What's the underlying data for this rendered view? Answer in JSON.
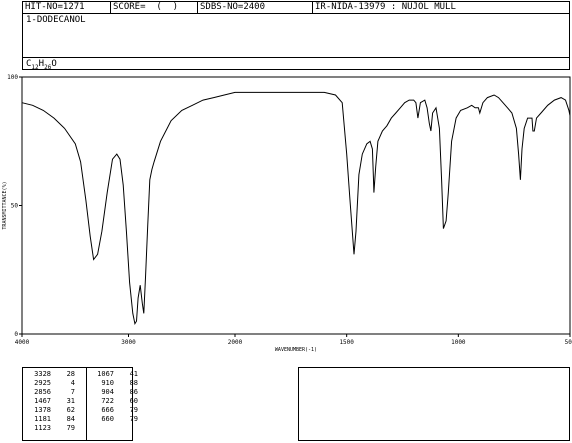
{
  "header": {
    "hit_no": "HIT-NO=1271",
    "score": "SCORE=  (  )",
    "sdbs_no": "SDBS-NO=2400",
    "ir_info": "IR-NIDA-13979 : NUJOL MULL"
  },
  "compound": {
    "name": "1-DODECANOL",
    "formula_c": "C",
    "formula_c_sub": "12",
    "formula_h": "H",
    "formula_h_sub": "26",
    "formula_o": "O"
  },
  "chart_data": {
    "type": "line",
    "xlabel": "WAVENUMBER(-1)",
    "ylabel": "TRANSMITTANCE(%)",
    "xlim": [
      4000,
      500
    ],
    "ylim": [
      0,
      100
    ],
    "x_ticks": [
      {
        "value": 4000,
        "label": "4000"
      },
      {
        "value": 3000,
        "label": "3000"
      },
      {
        "value": 2000,
        "label": "2000"
      },
      {
        "value": 1500,
        "label": "1500"
      },
      {
        "value": 1000,
        "label": "1000"
      },
      {
        "value": 500,
        "label": "500"
      }
    ],
    "y_ticks": [
      {
        "value": 100,
        "label": "100"
      },
      {
        "value": 50,
        "label": "50"
      },
      {
        "value": 0,
        "label": "0"
      }
    ],
    "series": [
      {
        "color": "#000000",
        "points": [
          [
            4000,
            90
          ],
          [
            3900,
            89
          ],
          [
            3800,
            87
          ],
          [
            3700,
            84
          ],
          [
            3600,
            80
          ],
          [
            3500,
            74
          ],
          [
            3450,
            67
          ],
          [
            3400,
            52
          ],
          [
            3360,
            38
          ],
          [
            3328,
            29
          ],
          [
            3290,
            31
          ],
          [
            3250,
            40
          ],
          [
            3200,
            55
          ],
          [
            3150,
            68
          ],
          [
            3110,
            70
          ],
          [
            3080,
            68
          ],
          [
            3050,
            58
          ],
          [
            3020,
            40
          ],
          [
            2990,
            20
          ],
          [
            2960,
            8
          ],
          [
            2940,
            4
          ],
          [
            2925,
            5
          ],
          [
            2910,
            14
          ],
          [
            2890,
            19
          ],
          [
            2870,
            12
          ],
          [
            2856,
            8
          ],
          [
            2840,
            22
          ],
          [
            2820,
            42
          ],
          [
            2800,
            60
          ],
          [
            2780,
            64
          ],
          [
            2760,
            67
          ],
          [
            2700,
            75
          ],
          [
            2600,
            83
          ],
          [
            2500,
            87
          ],
          [
            2400,
            89
          ],
          [
            2300,
            91
          ],
          [
            2200,
            92
          ],
          [
            2100,
            93
          ],
          [
            2000,
            94
          ],
          [
            1900,
            94
          ],
          [
            1800,
            94
          ],
          [
            1700,
            94
          ],
          [
            1600,
            94
          ],
          [
            1550,
            93
          ],
          [
            1520,
            90
          ],
          [
            1500,
            70
          ],
          [
            1485,
            52
          ],
          [
            1467,
            31
          ],
          [
            1458,
            40
          ],
          [
            1445,
            62
          ],
          [
            1430,
            70
          ],
          [
            1410,
            74
          ],
          [
            1395,
            75
          ],
          [
            1385,
            72
          ],
          [
            1380,
            60
          ],
          [
            1378,
            55
          ],
          [
            1370,
            65
          ],
          [
            1360,
            75
          ],
          [
            1340,
            79
          ],
          [
            1320,
            81
          ],
          [
            1300,
            84
          ],
          [
            1280,
            86
          ],
          [
            1260,
            88
          ],
          [
            1240,
            90
          ],
          [
            1220,
            91
          ],
          [
            1200,
            91
          ],
          [
            1190,
            90
          ],
          [
            1181,
            84
          ],
          [
            1170,
            90
          ],
          [
            1150,
            91
          ],
          [
            1140,
            88
          ],
          [
            1130,
            82
          ],
          [
            1123,
            79
          ],
          [
            1115,
            86
          ],
          [
            1100,
            88
          ],
          [
            1085,
            80
          ],
          [
            1075,
            60
          ],
          [
            1067,
            41
          ],
          [
            1055,
            44
          ],
          [
            1045,
            55
          ],
          [
            1030,
            75
          ],
          [
            1010,
            84
          ],
          [
            990,
            87
          ],
          [
            960,
            88
          ],
          [
            940,
            89
          ],
          [
            925,
            88
          ],
          [
            910,
            88
          ],
          [
            904,
            86
          ],
          [
            890,
            90
          ],
          [
            870,
            92
          ],
          [
            840,
            93
          ],
          [
            820,
            92
          ],
          [
            800,
            90
          ],
          [
            780,
            88
          ],
          [
            760,
            86
          ],
          [
            740,
            80
          ],
          [
            730,
            70
          ],
          [
            722,
            60
          ],
          [
            715,
            72
          ],
          [
            705,
            80
          ],
          [
            690,
            84
          ],
          [
            670,
            84
          ],
          [
            666,
            79
          ],
          [
            660,
            79
          ],
          [
            650,
            84
          ],
          [
            630,
            86
          ],
          [
            600,
            89
          ],
          [
            570,
            91
          ],
          [
            540,
            92
          ],
          [
            520,
            91
          ],
          [
            505,
            87
          ],
          [
            500,
            85
          ]
        ]
      }
    ]
  },
  "peaks": {
    "left": [
      [
        "3328",
        "28"
      ],
      [
        "2925",
        "4"
      ],
      [
        "2856",
        "7"
      ],
      [
        "1467",
        "31"
      ],
      [
        "1378",
        "62"
      ],
      [
        "1181",
        "84"
      ],
      [
        "1123",
        "79"
      ]
    ],
    "right": [
      [
        "1067",
        "41"
      ],
      [
        "910",
        "88"
      ],
      [
        "904",
        "86"
      ],
      [
        "722",
        "60"
      ],
      [
        "666",
        "79"
      ],
      [
        "660",
        "79"
      ]
    ]
  }
}
